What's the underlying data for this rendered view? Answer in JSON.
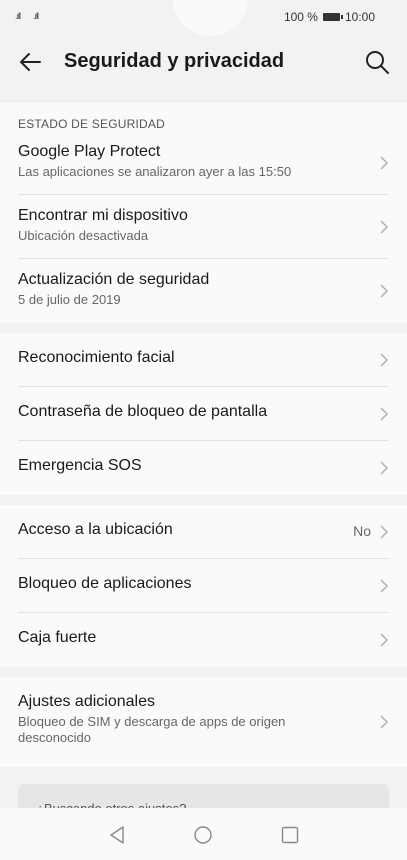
{
  "status_bar": {
    "signal1": ".ıll",
    "signal2": ".ıll",
    "battery": "100 %",
    "time": "10:00"
  },
  "header": {
    "title": "Seguridad y privacidad",
    "back_icon": "arrow-left-icon",
    "search_icon": "search-icon"
  },
  "security_status": {
    "header": "ESTADO DE SEGURIDAD",
    "items": [
      {
        "label": "Google Play Protect",
        "sub": "Las aplicaciones se analizaron ayer a las 15:50"
      },
      {
        "label": "Encontrar mi dispositivo",
        "sub": "Ubicación desactivada"
      },
      {
        "label": "Actualización de seguridad",
        "sub": "5 de julio de 2019"
      }
    ]
  },
  "unlock_section": {
    "items": [
      {
        "label": "Reconocimiento facial"
      },
      {
        "label": "Contraseña de bloqueo de pantalla"
      },
      {
        "label": "Emergencia SOS"
      }
    ]
  },
  "privacy_section": {
    "items": [
      {
        "label": "Acceso a la ubicación",
        "value": "No"
      },
      {
        "label": "Bloqueo de aplicaciones"
      },
      {
        "label": "Caja fuerte"
      }
    ]
  },
  "more_section": {
    "items": [
      {
        "label": "Ajustes adicionales",
        "sub": "Bloqueo de SIM y descarga de apps de origen desconocido"
      }
    ]
  },
  "hint": {
    "text": "¿Buscando otros ajustes?"
  },
  "navbar": {
    "back": "triangle-back-icon",
    "home": "circle-home-icon",
    "recents": "square-recents-icon"
  },
  "colors": {
    "background": "#f2f2f2",
    "card": "#fafafa",
    "divider": "#e1e1e1",
    "chevron": "#b0b0b0"
  }
}
